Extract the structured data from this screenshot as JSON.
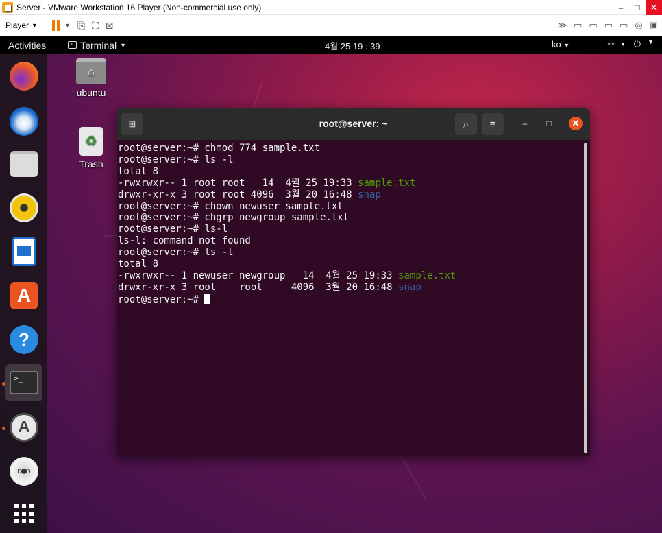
{
  "vmware": {
    "title": "Server - VMware Workstation 16 Player (Non-commercial use only)",
    "player_label": "Player",
    "min_label": "–",
    "max_label": "□",
    "close_label": "✕"
  },
  "topbar": {
    "activities": "Activities",
    "app_menu": "Terminal",
    "clock": "4월 25  19 : 39",
    "lang": "ko"
  },
  "desktop": {
    "home_label": "ubuntu",
    "trash_label": "Trash"
  },
  "terminal": {
    "title": "root@server: ~",
    "lines": [
      {
        "text": "root@server:~# chmod 774 sample.txt",
        "suffix": "",
        "suffix_color": ""
      },
      {
        "text": "root@server:~# ls -l",
        "suffix": "",
        "suffix_color": ""
      },
      {
        "text": "total 8",
        "suffix": "",
        "suffix_color": ""
      },
      {
        "text": "-rwxrwxr-- 1 root root   14  4월 25 19:33 ",
        "suffix": "sample.txt",
        "suffix_color": "green"
      },
      {
        "text": "drwxr-xr-x 3 root root 4096  3월 20 16:48 ",
        "suffix": "snap",
        "suffix_color": "blue"
      },
      {
        "text": "root@server:~# chown newuser sample.txt",
        "suffix": "",
        "suffix_color": ""
      },
      {
        "text": "root@server:~# chgrp newgroup sample.txt",
        "suffix": "",
        "suffix_color": ""
      },
      {
        "text": "root@server:~# ls-l",
        "suffix": "",
        "suffix_color": ""
      },
      {
        "text": "ls-l: command not found",
        "suffix": "",
        "suffix_color": ""
      },
      {
        "text": "root@server:~# ls -l",
        "suffix": "",
        "suffix_color": ""
      },
      {
        "text": "total 8",
        "suffix": "",
        "suffix_color": ""
      },
      {
        "text": "-rwxrwxr-- 1 newuser newgroup   14  4월 25 19:33 ",
        "suffix": "sample.txt",
        "suffix_color": "green"
      },
      {
        "text": "drwxr-xr-x 3 root    root     4096  3월 20 16:48 ",
        "suffix": "snap",
        "suffix_color": "blue"
      }
    ],
    "prompt": "root@server:~# "
  },
  "dock": [
    {
      "name": "firefox-icon"
    },
    {
      "name": "thunderbird-icon"
    },
    {
      "name": "files-icon"
    },
    {
      "name": "rhythmbox-icon"
    },
    {
      "name": "libreoffice-writer-icon"
    },
    {
      "name": "ubuntu-software-icon"
    },
    {
      "name": "help-icon"
    },
    {
      "name": "terminal-icon"
    },
    {
      "name": "software-updater-icon"
    },
    {
      "name": "dvd-icon"
    },
    {
      "name": "show-applications-icon"
    }
  ]
}
